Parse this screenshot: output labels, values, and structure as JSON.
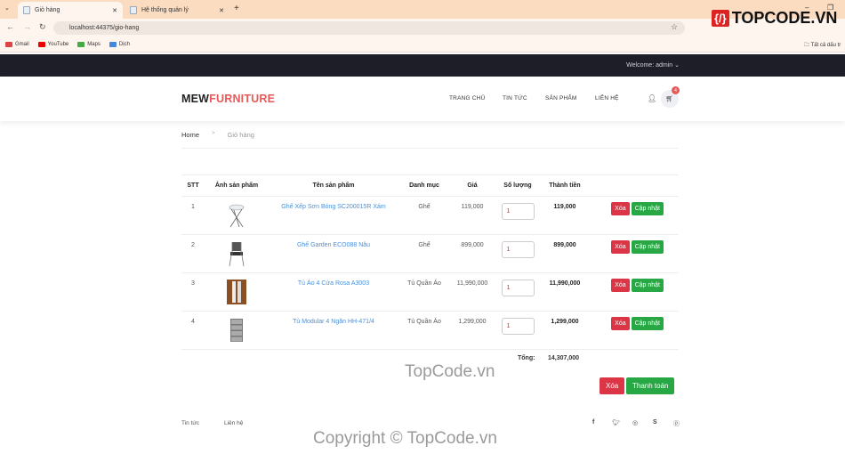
{
  "browser": {
    "tabs": [
      {
        "label": "Giỏ hàng",
        "active": true
      },
      {
        "label": "Hệ thống quản lý",
        "active": false
      }
    ],
    "url": "localhost:44375/gio-hang",
    "bookmarks": [
      "Gmail",
      "YouTube",
      "Maps",
      "Dịch"
    ],
    "all_bookmarks": "Tất cả dấu tr"
  },
  "topbar": {
    "welcome": "Welcome: admin"
  },
  "header": {
    "logo_a": "MEW",
    "logo_b": "FURNITURE",
    "nav": [
      "TRANG CHỦ",
      "TIN TỨC",
      "SẢN PHẨM",
      "LIÊN HỆ"
    ],
    "cart_count": "4"
  },
  "breadcrumb": {
    "home": "Home",
    "sep": ">",
    "current": "Giỏ hàng"
  },
  "cart": {
    "headers": [
      "STT",
      "Ảnh sản phẩm",
      "Tên sản phẩm",
      "Danh mục",
      "Giá",
      "Số lượng",
      "Thành tiền"
    ],
    "rows": [
      {
        "stt": "1",
        "name": "Ghế Xếp Sơn Bóng SC200015R Xám",
        "category": "Ghế",
        "price": "119,000",
        "qty": "1",
        "total": "119,000",
        "image": "folding-table"
      },
      {
        "stt": "2",
        "name": "Ghế Garden ECO088 Nâu",
        "category": "Ghế",
        "price": "899,000",
        "qty": "1",
        "total": "899,000",
        "image": "garden-chair"
      },
      {
        "stt": "3",
        "name": "Tủ Áo 4 Cửa Rosa A3003",
        "category": "Tủ Quần Áo",
        "price": "11,990,000",
        "qty": "1",
        "total": "11,990,000",
        "image": "wardrobe"
      },
      {
        "stt": "4",
        "name": "Tủ Modular 4 Ngăn HH-471/4",
        "category": "Tủ Quần Áo",
        "price": "1,299,000",
        "qty": "1",
        "total": "1,299,000",
        "image": "drawer-cabinet"
      }
    ],
    "delete_label": "Xóa",
    "update_label": "Cập nhật",
    "total_label": "Tổng:",
    "total_value": "14,307,000",
    "clear_label": "Xóa",
    "checkout_label": "Thanh toán"
  },
  "footer": {
    "links": [
      "Tin tức",
      "Liên hệ"
    ],
    "social": [
      "facebook",
      "twitter",
      "instagram",
      "skype",
      "pinterest"
    ]
  },
  "watermark": {
    "logo": "TOPCODE.VN",
    "mid": "TopCode.vn",
    "bottom": "Copyright © TopCode.vn"
  },
  "colors": {
    "accent": "#e85a5a",
    "danger": "#dc3545",
    "success": "#28a745",
    "link": "#4a90d9",
    "topbar": "#1e1e28"
  }
}
